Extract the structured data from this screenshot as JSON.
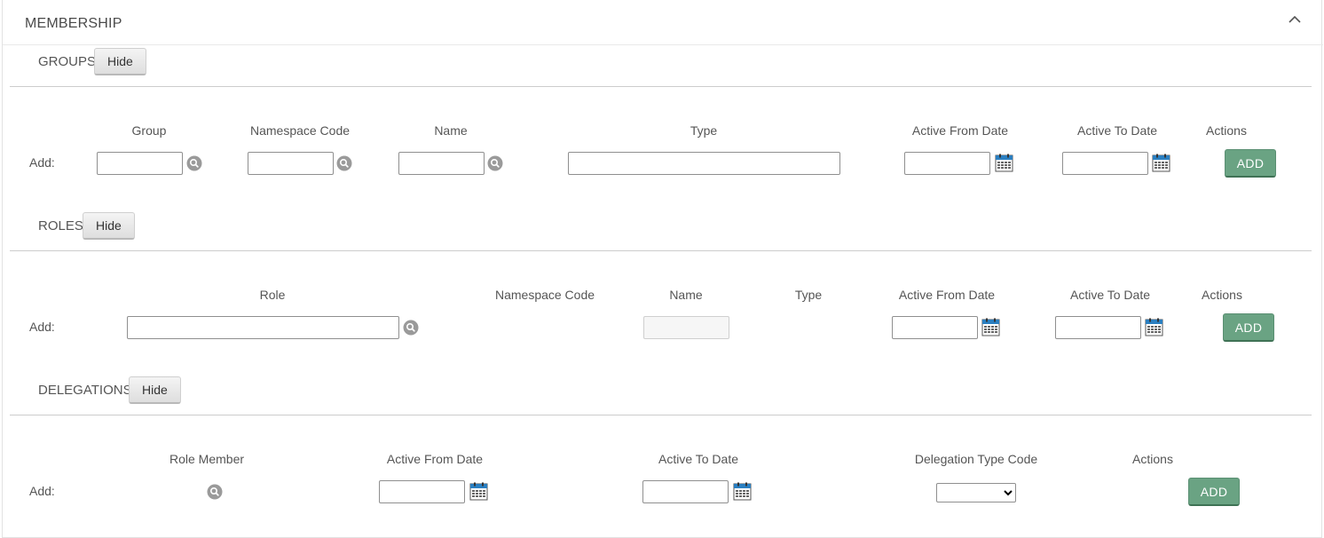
{
  "panel": {
    "title": "MEMBERSHIP",
    "collapse_icon": "chevron-up-icon"
  },
  "hide_label": "Hide",
  "add_row_label": "Add:",
  "add_button_label": "ADD",
  "colors": {
    "add_button": "#6aa383",
    "lookup_icon": "#9a9a9a",
    "calendar_icon": "#2a7fc1"
  },
  "groups": {
    "label": "GROUPS",
    "columns": [
      "Group",
      "Namespace Code",
      "Name",
      "Type",
      "Active From Date",
      "Active To Date",
      "Actions"
    ]
  },
  "roles": {
    "label": "ROLES",
    "columns": [
      "Role",
      "Namespace Code",
      "Name",
      "Type",
      "Active From Date",
      "Active To Date",
      "Actions"
    ]
  },
  "delegations": {
    "label": "DELEGATIONS",
    "columns": [
      "Role Member",
      "Active From Date",
      "Active To Date",
      "Delegation Type Code",
      "Actions"
    ],
    "delegation_type_selected": ""
  }
}
